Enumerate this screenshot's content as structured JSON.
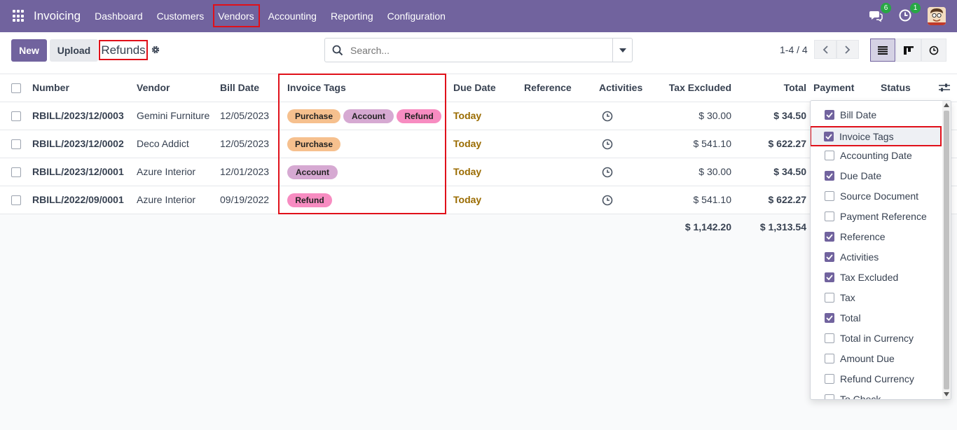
{
  "app": {
    "name": "Invoicing"
  },
  "nav": {
    "items": [
      "Dashboard",
      "Customers",
      "Vendors",
      "Accounting",
      "Reporting",
      "Configuration"
    ],
    "messages_count": "6",
    "activities_count": "1"
  },
  "control": {
    "new_label": "New",
    "upload_label": "Upload",
    "breadcrumb": "Refunds",
    "search_placeholder": "Search...",
    "pager": "1-4 / 4"
  },
  "columns": {
    "number": "Number",
    "vendor": "Vendor",
    "bill_date": "Bill Date",
    "invoice_tags": "Invoice Tags",
    "due_date": "Due Date",
    "reference": "Reference",
    "activities": "Activities",
    "tax_excluded": "Tax Excluded",
    "total": "Total",
    "payment": "Payment",
    "status": "Status"
  },
  "rows": [
    {
      "number": "RBILL/2023/12/0003",
      "vendor": "Gemini Furniture",
      "bill_date": "12/05/2023",
      "tags": [
        "Purchase",
        "Account",
        "Refund"
      ],
      "due": "Today",
      "tax_excluded": "$ 30.00",
      "total": "$ 34.50"
    },
    {
      "number": "RBILL/2023/12/0002",
      "vendor": "Deco Addict",
      "bill_date": "12/05/2023",
      "tags": [
        "Purchase"
      ],
      "due": "Today",
      "tax_excluded": "$ 541.10",
      "total": "$ 622.27"
    },
    {
      "number": "RBILL/2023/12/0001",
      "vendor": "Azure Interior",
      "bill_date": "12/01/2023",
      "tags": [
        "Account"
      ],
      "due": "Today",
      "tax_excluded": "$ 30.00",
      "total": "$ 34.50"
    },
    {
      "number": "RBILL/2022/09/0001",
      "vendor": "Azure Interior",
      "bill_date": "09/19/2022",
      "tags": [
        "Refund"
      ],
      "due": "Today",
      "tax_excluded": "$ 541.10",
      "total": "$ 622.27"
    }
  ],
  "totals": {
    "tax_excluded": "$ 1,142.20",
    "total": "$ 1,313.54"
  },
  "optional_columns": [
    {
      "label": "Bill Date",
      "checked": true
    },
    {
      "label": "Invoice Tags",
      "checked": true
    },
    {
      "label": "Accounting Date",
      "checked": false
    },
    {
      "label": "Due Date",
      "checked": true
    },
    {
      "label": "Source Document",
      "checked": false
    },
    {
      "label": "Payment Reference",
      "checked": false
    },
    {
      "label": "Reference",
      "checked": true
    },
    {
      "label": "Activities",
      "checked": true
    },
    {
      "label": "Tax Excluded",
      "checked": true
    },
    {
      "label": "Tax",
      "checked": false
    },
    {
      "label": "Total",
      "checked": true
    },
    {
      "label": "Total in Currency",
      "checked": false
    },
    {
      "label": "Amount Due",
      "checked": false
    },
    {
      "label": "Refund Currency",
      "checked": false
    },
    {
      "label": "To Check",
      "checked": false
    }
  ],
  "colors": {
    "brand": "#71639e",
    "highlight": "#e0101a",
    "due": "#9a6b00"
  },
  "icons": [
    "apps-icon",
    "chat-icon",
    "activity-clock-icon",
    "gear-icon",
    "search-icon",
    "caret-down-icon",
    "list-view-icon",
    "kanban-view-icon",
    "activity-view-icon",
    "optional-columns-icon"
  ]
}
